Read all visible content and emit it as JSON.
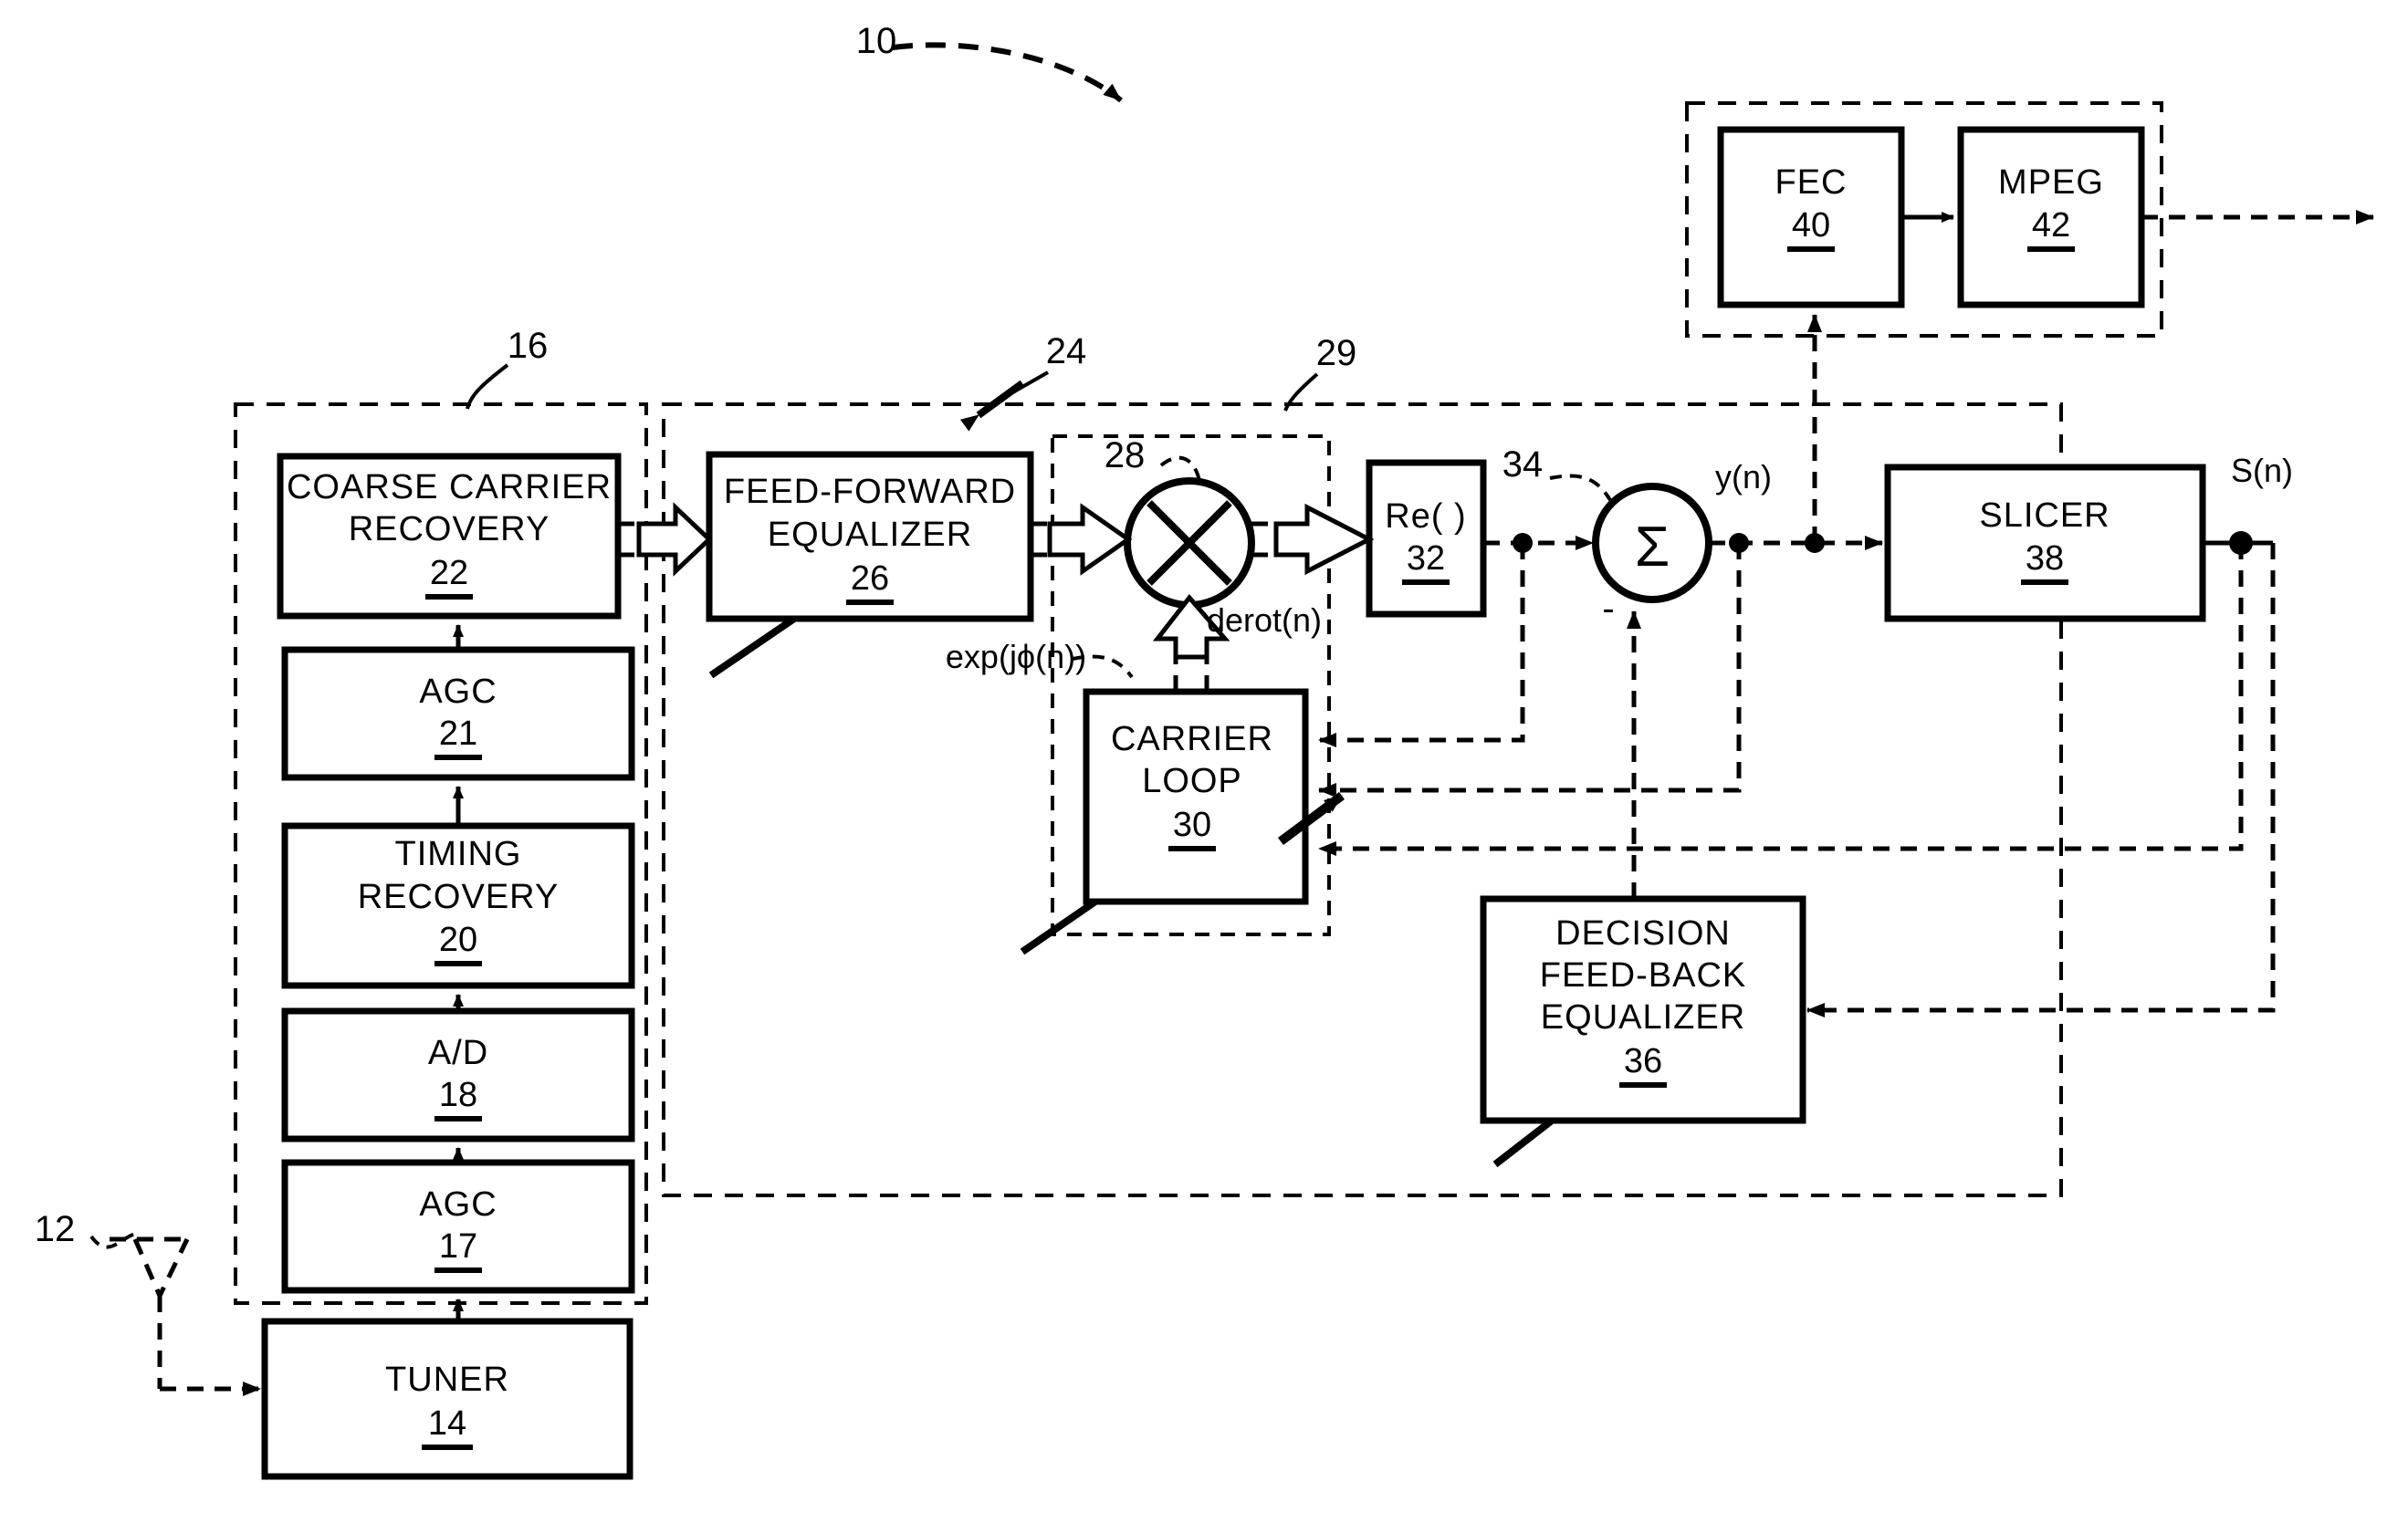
{
  "figure": {
    "reference_label": "10"
  },
  "blocks": {
    "tuner": {
      "lines": [
        "TUNER"
      ],
      "num": "14"
    },
    "agc17": {
      "lines": [
        "AGC"
      ],
      "num": "17"
    },
    "ad18": {
      "lines": [
        "A/D"
      ],
      "num": "18"
    },
    "timing20": {
      "lines": [
        "TIMING",
        "RECOVERY"
      ],
      "num": "20"
    },
    "agc21": {
      "lines": [
        "AGC"
      ],
      "num": "21"
    },
    "ccr22": {
      "lines": [
        "COARSE   CARRIER",
        "RECOVERY"
      ],
      "num": "22"
    },
    "ffe26": {
      "lines": [
        "FEED-FORWARD",
        "EQUALIZER"
      ],
      "num": "26"
    },
    "carrier30": {
      "lines": [
        "CARRIER",
        "LOOP"
      ],
      "num": "30"
    },
    "re32": {
      "lines": [
        "Re( )"
      ],
      "num": "32"
    },
    "dfe36": {
      "lines": [
        "DECISION",
        "FEED-BACK",
        "EQUALIZER"
      ],
      "num": "36"
    },
    "slicer38": {
      "lines": [
        "SLICER"
      ],
      "num": "38"
    },
    "fec40": {
      "lines": [
        "FEC"
      ],
      "num": "40"
    },
    "mpeg42": {
      "lines": [
        "MPEG"
      ],
      "num": "42"
    }
  },
  "group_refs": {
    "demod_front_end": "16",
    "equalizer_group": "24",
    "derotator_group": "29",
    "multiplier": "28",
    "summer": "34"
  },
  "signals": {
    "antenna": "12",
    "exp_phase": "exp(jϕ(n))",
    "derot": "derot(n)",
    "y_of_n": "y(n)",
    "s_of_n": "S(n)",
    "summer_minus": "-",
    "multiplier_glyph": "✕",
    "summer_glyph": "Σ"
  },
  "colors": {
    "ink": "#000000",
    "paper": "#ffffff"
  }
}
